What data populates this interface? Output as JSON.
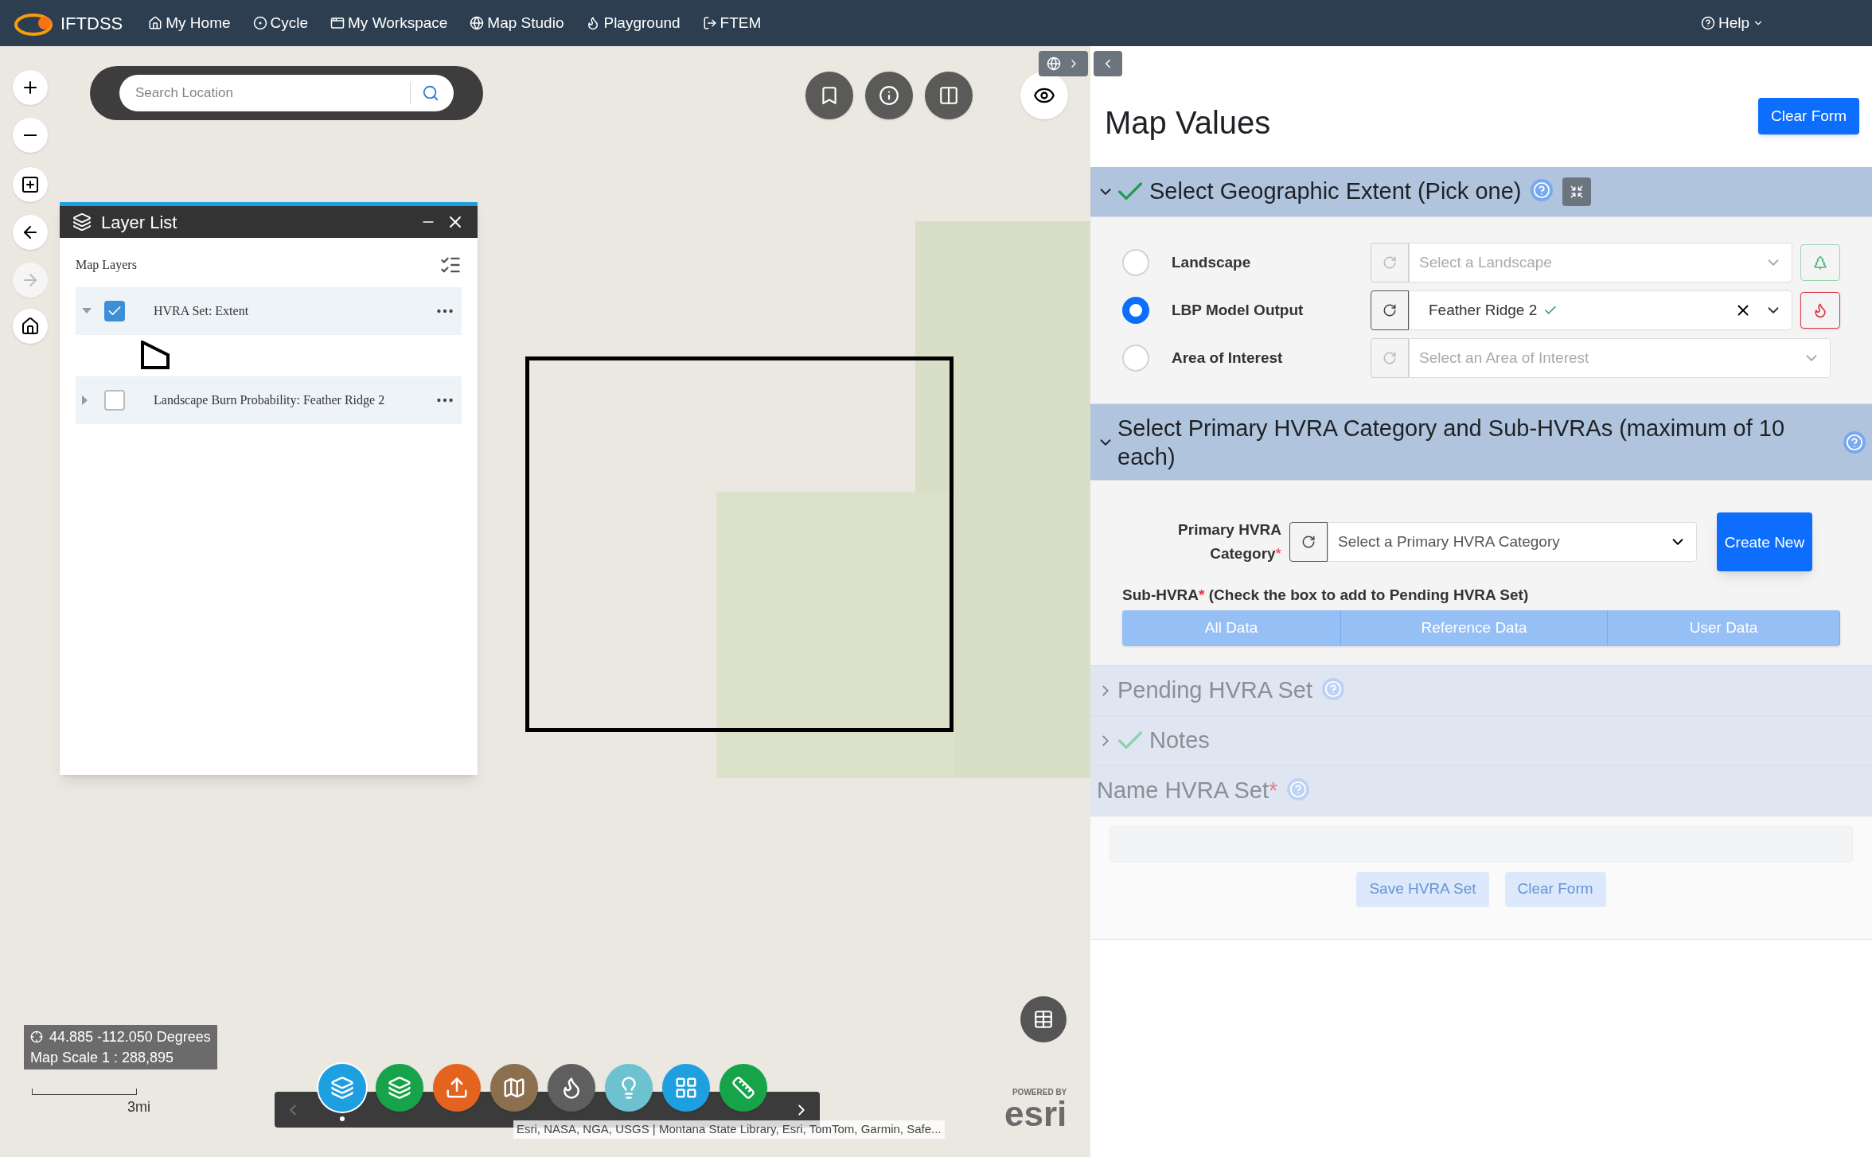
{
  "nav": {
    "logo": "IFTDSS",
    "items": [
      {
        "label": "My Home"
      },
      {
        "label": "Cycle"
      },
      {
        "label": "My Workspace"
      },
      {
        "label": "Map Studio"
      },
      {
        "label": "Playground"
      },
      {
        "label": "FTEM"
      }
    ],
    "help": "Help"
  },
  "map": {
    "search_placeholder": "Search Location",
    "layer_list": {
      "title": "Layer List",
      "heading": "Map Layers",
      "layers": [
        {
          "name": "HVRA Set: Extent",
          "checked": true,
          "expanded": true
        },
        {
          "name": "Landscape Burn Probability: Feather Ridge 2",
          "checked": false,
          "expanded": false
        }
      ]
    },
    "coordinates": "44.885 -112.050 Degrees",
    "scale": "Map Scale 1 : 288,895",
    "scale_bar": "3mi",
    "attribution": "Esri, NASA, NGA, USGS | Montana State Library, Esri, TomTom, Garmin, Safe...",
    "esri_powered": "POWERED BY",
    "esri_logo": "esri",
    "tools": [
      {
        "color": "#1e9fe0",
        "selected": true
      },
      {
        "color": "#16a34a",
        "selected": false
      },
      {
        "color": "#e4641f",
        "selected": false
      },
      {
        "color": "#8b6f4e",
        "selected": false
      },
      {
        "color": "#5f5f5f",
        "selected": false
      },
      {
        "color": "#6cc3cf",
        "selected": false
      },
      {
        "color": "#1e9fe0",
        "selected": false
      },
      {
        "color": "#16a34a",
        "selected": false
      }
    ]
  },
  "panel": {
    "title": "Map Values",
    "clear_form": "Clear Form",
    "extent": {
      "title": "Select Geographic Extent (Pick one)",
      "expanded": true,
      "complete": true,
      "options": [
        {
          "label": "Landscape",
          "selected": false,
          "placeholder": "Select a Landscape",
          "kind": "tree"
        },
        {
          "label": "LBP Model Output",
          "selected": true,
          "value": "Feather Ridge 2",
          "kind": "fire"
        },
        {
          "label": "Area of Interest",
          "selected": false,
          "placeholder": "Select an Area of Interest",
          "kind": "none"
        }
      ]
    },
    "primary": {
      "title": "Select Primary HVRA Category and Sub-HVRAs (maximum of 10 each)",
      "expanded": true,
      "label": "Primary HVRA Category",
      "required_mark": "*",
      "placeholder": "Select a Primary HVRA Category",
      "create": "Create New",
      "sub_label": "Sub-HVRA",
      "sub_hint": "(Check the box to add to Pending HVRA Set)",
      "tabs": [
        "All Data",
        "Reference Data",
        "User Data"
      ]
    },
    "pending": {
      "title": "Pending HVRA Set",
      "expanded": false,
      "complete": false
    },
    "notes": {
      "title": "Notes",
      "expanded": false,
      "complete": true
    },
    "name_set": {
      "title": "Name HVRA Set",
      "required_mark": "*"
    },
    "buttons": [
      {
        "label": "Save HVRA Set",
        "disabled": true
      },
      {
        "label": "Clear Form",
        "disabled": true
      }
    ]
  }
}
